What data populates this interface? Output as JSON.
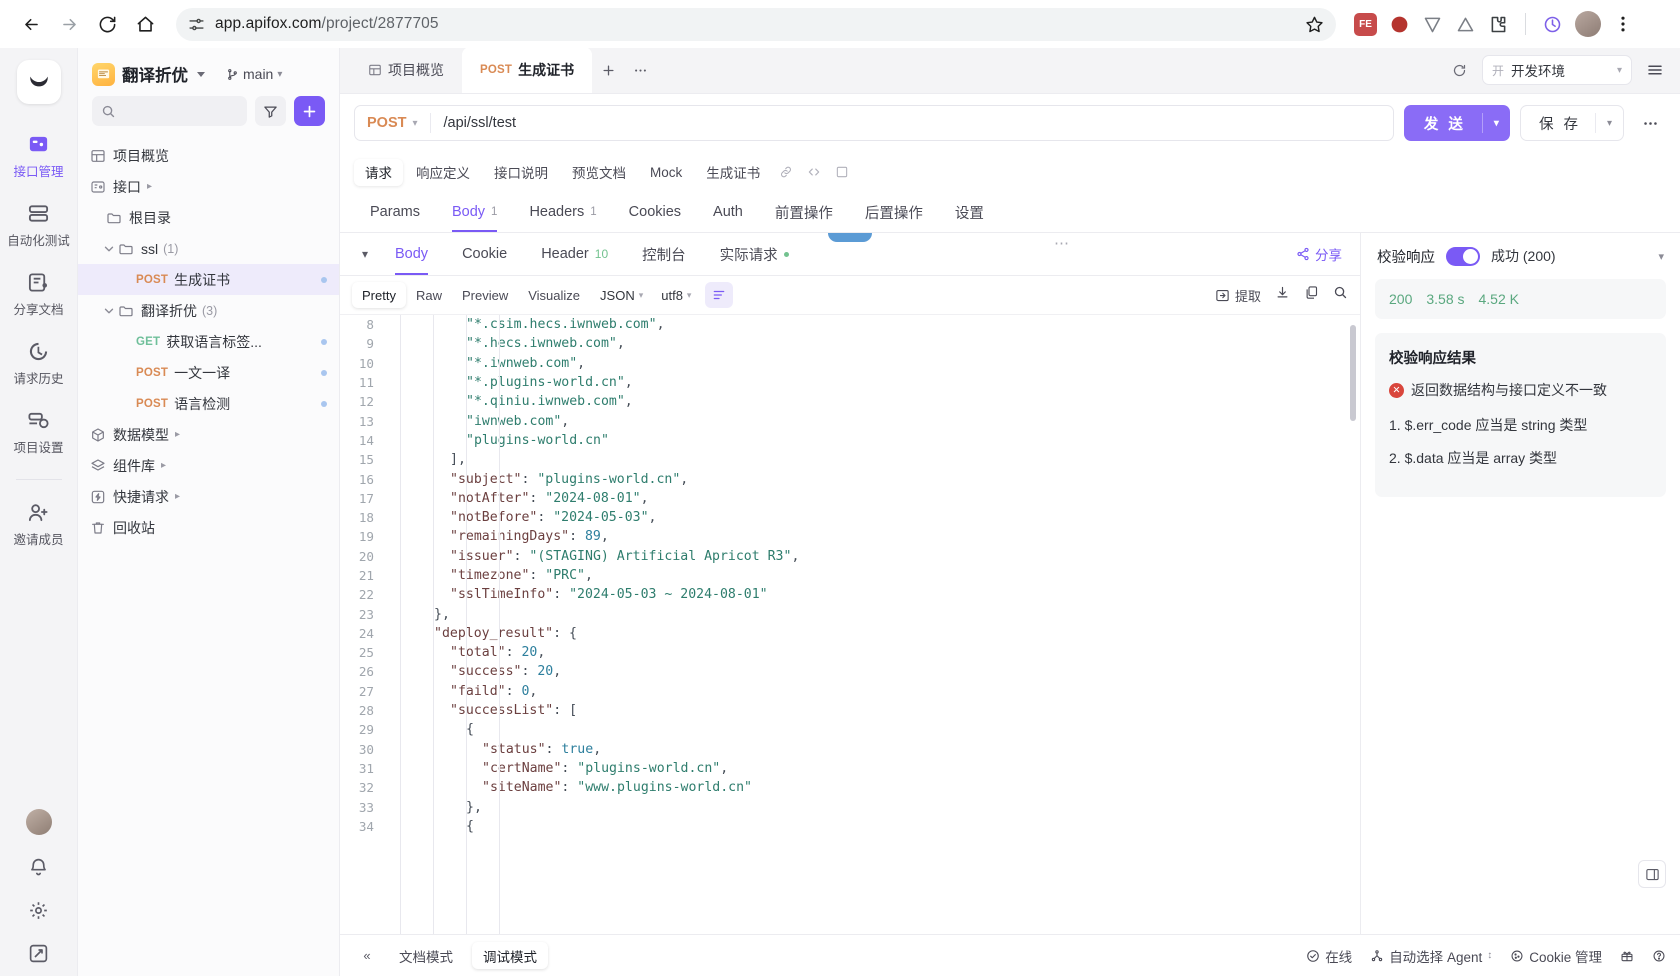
{
  "browser": {
    "url_prefix": "app.apifox.com",
    "url_suffix": "/project/2877705",
    "back_icon": "back-arrow-icon",
    "forward_icon": "forward-arrow-icon",
    "reload_icon": "reload-icon",
    "home_icon": "home-icon",
    "site_info_icon": "site-settings-icon",
    "bookmark_icon": "star-icon",
    "ext1_label": "FE",
    "menu_icon": "kebab-menu-icon"
  },
  "rail": {
    "logo": "apifox-logo",
    "items": [
      {
        "label": "接口管理",
        "icon": "api-management-icon",
        "active": true
      },
      {
        "label": "自动化测试",
        "icon": "automated-test-icon",
        "active": false
      },
      {
        "label": "分享文档",
        "icon": "share-doc-icon",
        "active": false
      },
      {
        "label": "请求历史",
        "icon": "history-icon",
        "active": false
      },
      {
        "label": "项目设置",
        "icon": "project-settings-icon",
        "active": false
      }
    ],
    "invite": {
      "label": "邀请成员",
      "icon": "invite-member-icon"
    },
    "bottom": [
      {
        "icon": "notification-bell-icon"
      },
      {
        "icon": "settings-gear-icon"
      },
      {
        "icon": "feedback-icon"
      }
    ]
  },
  "sidebar": {
    "project_name": "翻译折优",
    "project_icon": "project-thumbnail-icon",
    "branch": "main",
    "branch_icon": "git-branch-icon",
    "search_placeholder": "",
    "filter_icon": "filter-icon",
    "add_icon": "plus-icon",
    "tree": [
      {
        "label": "项目概览",
        "icon": "overview-icon",
        "indent": 0,
        "type": "node"
      },
      {
        "label": "接口",
        "icon": "api-folder-icon",
        "indent": 0,
        "type": "node",
        "arrow": true
      },
      {
        "label": "根目录",
        "icon": "folder-icon",
        "indent": 1,
        "type": "folder"
      },
      {
        "label": "ssl",
        "icon": "folder-icon",
        "indent": 1,
        "type": "folder",
        "count": "(1)",
        "expanded": true
      },
      {
        "label": "生成证书",
        "verb": "POST",
        "indent": 2,
        "type": "api",
        "selected": true,
        "dot": true
      },
      {
        "label": "翻译折优",
        "icon": "folder-icon",
        "indent": 1,
        "type": "folder",
        "count": "(3)",
        "expanded": true
      },
      {
        "label": "获取语言标签...",
        "verb": "GET",
        "indent": 2,
        "type": "api",
        "dot": true
      },
      {
        "label": "一文一译",
        "verb": "POST",
        "indent": 2,
        "type": "api",
        "dot": true
      },
      {
        "label": "语言检测",
        "verb": "POST",
        "indent": 2,
        "type": "api",
        "dot": true
      },
      {
        "label": "数据模型",
        "icon": "data-model-icon",
        "indent": 0,
        "type": "node",
        "arrow": true
      },
      {
        "label": "组件库",
        "icon": "component-library-icon",
        "indent": 0,
        "type": "node",
        "arrow": true
      },
      {
        "label": "快捷请求",
        "icon": "quick-request-icon",
        "indent": 0,
        "type": "node",
        "arrow": true
      },
      {
        "label": "回收站",
        "icon": "trash-icon",
        "indent": 0,
        "type": "node"
      }
    ]
  },
  "tabs": {
    "items": [
      {
        "label": "项目概览",
        "icon": "overview-icon",
        "active": false
      },
      {
        "label": "生成证书",
        "verb": "POST",
        "active": true
      }
    ],
    "add_icon": "plus-icon",
    "more_icon": "ellipsis-icon",
    "refresh_icon": "refresh-icon",
    "env_badge": "开",
    "env_label": "开发环境",
    "menu_icon": "list-menu-icon"
  },
  "request": {
    "method": "POST",
    "url": "/api/ssl/test",
    "send_label": "发 送",
    "save_label": "保 存",
    "more_icon": "ellipsis-icon"
  },
  "doc_tabs": {
    "items": [
      {
        "label": "请求",
        "active": true
      },
      {
        "label": "响应定义",
        "active": false
      },
      {
        "label": "接口说明",
        "active": false
      },
      {
        "label": "预览文档",
        "active": false
      },
      {
        "label": "Mock",
        "active": false
      },
      {
        "label": "生成证书",
        "active": false
      }
    ],
    "icons": [
      "link-icon",
      "code-icon",
      "panel-icon"
    ]
  },
  "sub_tabs": {
    "items": [
      {
        "label": "Params",
        "badge": "",
        "active": false
      },
      {
        "label": "Body",
        "badge": "1",
        "active": true
      },
      {
        "label": "Headers",
        "badge": "1",
        "active": false
      },
      {
        "label": "Cookies",
        "badge": "",
        "active": false
      },
      {
        "label": "Auth",
        "badge": "",
        "active": false
      },
      {
        "label": "前置操作",
        "badge": "",
        "active": false
      },
      {
        "label": "后置操作",
        "badge": "",
        "active": false
      },
      {
        "label": "设置",
        "badge": "",
        "active": false
      }
    ]
  },
  "response": {
    "collapse_icon": "chevron-down-icon",
    "tabs": [
      {
        "label": "Body",
        "badge": "",
        "active": true
      },
      {
        "label": "Cookie",
        "badge": "",
        "active": false
      },
      {
        "label": "Header",
        "badge": "10",
        "active": false
      },
      {
        "label": "控制台",
        "badge": "",
        "active": false
      },
      {
        "label": "实际请求",
        "badge": "",
        "active": false,
        "dot": true
      }
    ],
    "share_label": "分享",
    "share_icon": "share-icon",
    "format": {
      "modes": [
        {
          "label": "Pretty",
          "active": true
        },
        {
          "label": "Raw",
          "active": false
        },
        {
          "label": "Preview",
          "active": false
        },
        {
          "label": "Visualize",
          "active": false
        }
      ],
      "lang": "JSON",
      "encoding": "utf8",
      "wrap_icon": "word-wrap-icon",
      "extract_label": "提取",
      "extract_icon": "extract-icon",
      "download_icon": "download-icon",
      "copy_icon": "copy-icon",
      "search_icon": "search-icon"
    },
    "code_lines": [
      {
        "num": "8",
        "indent": 5,
        "tokens": [
          {
            "t": "s",
            "v": "\"*.csim.hecs.iwnweb.com\""
          },
          {
            "t": "p",
            "v": ","
          }
        ]
      },
      {
        "num": "9",
        "indent": 5,
        "tokens": [
          {
            "t": "s",
            "v": "\"*.hecs.iwnweb.com\""
          },
          {
            "t": "p",
            "v": ","
          }
        ]
      },
      {
        "num": "10",
        "indent": 5,
        "tokens": [
          {
            "t": "s",
            "v": "\"*.iwnweb.com\""
          },
          {
            "t": "p",
            "v": ","
          }
        ]
      },
      {
        "num": "11",
        "indent": 5,
        "tokens": [
          {
            "t": "s",
            "v": "\"*.plugins-world.cn\""
          },
          {
            "t": "p",
            "v": ","
          }
        ]
      },
      {
        "num": "12",
        "indent": 5,
        "tokens": [
          {
            "t": "s",
            "v": "\"*.qiniu.iwnweb.com\""
          },
          {
            "t": "p",
            "v": ","
          }
        ]
      },
      {
        "num": "13",
        "indent": 5,
        "tokens": [
          {
            "t": "s",
            "v": "\"iwnweb.com\""
          },
          {
            "t": "p",
            "v": ","
          }
        ]
      },
      {
        "num": "14",
        "indent": 5,
        "tokens": [
          {
            "t": "s",
            "v": "\"plugins-world.cn\""
          }
        ]
      },
      {
        "num": "15",
        "indent": 4,
        "tokens": [
          {
            "t": "p",
            "v": "],"
          }
        ]
      },
      {
        "num": "16",
        "indent": 4,
        "tokens": [
          {
            "t": "k",
            "v": "\"subject\""
          },
          {
            "t": "p",
            "v": ": "
          },
          {
            "t": "s",
            "v": "\"plugins-world.cn\""
          },
          {
            "t": "p",
            "v": ","
          }
        ]
      },
      {
        "num": "17",
        "indent": 4,
        "tokens": [
          {
            "t": "k",
            "v": "\"notAfter\""
          },
          {
            "t": "p",
            "v": ": "
          },
          {
            "t": "s",
            "v": "\"2024-08-01\""
          },
          {
            "t": "p",
            "v": ","
          }
        ]
      },
      {
        "num": "18",
        "indent": 4,
        "tokens": [
          {
            "t": "k",
            "v": "\"notBefore\""
          },
          {
            "t": "p",
            "v": ": "
          },
          {
            "t": "s",
            "v": "\"2024-05-03\""
          },
          {
            "t": "p",
            "v": ","
          }
        ]
      },
      {
        "num": "19",
        "indent": 4,
        "tokens": [
          {
            "t": "k",
            "v": "\"remainingDays\""
          },
          {
            "t": "p",
            "v": ": "
          },
          {
            "t": "n",
            "v": "89"
          },
          {
            "t": "p",
            "v": ","
          }
        ]
      },
      {
        "num": "20",
        "indent": 4,
        "tokens": [
          {
            "t": "k",
            "v": "\"issuer\""
          },
          {
            "t": "p",
            "v": ": "
          },
          {
            "t": "s",
            "v": "\"(STAGING) Artificial Apricot R3\""
          },
          {
            "t": "p",
            "v": ","
          }
        ]
      },
      {
        "num": "21",
        "indent": 4,
        "tokens": [
          {
            "t": "k",
            "v": "\"timezone\""
          },
          {
            "t": "p",
            "v": ": "
          },
          {
            "t": "s",
            "v": "\"PRC\""
          },
          {
            "t": "p",
            "v": ","
          }
        ]
      },
      {
        "num": "22",
        "indent": 4,
        "tokens": [
          {
            "t": "k",
            "v": "\"sslTimeInfo\""
          },
          {
            "t": "p",
            "v": ": "
          },
          {
            "t": "s",
            "v": "\"2024-05-03 ~ 2024-08-01\""
          }
        ]
      },
      {
        "num": "23",
        "indent": 3,
        "tokens": [
          {
            "t": "p",
            "v": "},"
          }
        ]
      },
      {
        "num": "24",
        "indent": 3,
        "tokens": [
          {
            "t": "k",
            "v": "\"deploy_result\""
          },
          {
            "t": "p",
            "v": ": {"
          }
        ]
      },
      {
        "num": "25",
        "indent": 4,
        "tokens": [
          {
            "t": "k",
            "v": "\"total\""
          },
          {
            "t": "p",
            "v": ": "
          },
          {
            "t": "n",
            "v": "20"
          },
          {
            "t": "p",
            "v": ","
          }
        ]
      },
      {
        "num": "26",
        "indent": 4,
        "tokens": [
          {
            "t": "k",
            "v": "\"success\""
          },
          {
            "t": "p",
            "v": ": "
          },
          {
            "t": "n",
            "v": "20"
          },
          {
            "t": "p",
            "v": ","
          }
        ]
      },
      {
        "num": "27",
        "indent": 4,
        "tokens": [
          {
            "t": "k",
            "v": "\"faild\""
          },
          {
            "t": "p",
            "v": ": "
          },
          {
            "t": "n",
            "v": "0"
          },
          {
            "t": "p",
            "v": ","
          }
        ]
      },
      {
        "num": "28",
        "indent": 4,
        "tokens": [
          {
            "t": "k",
            "v": "\"successList\""
          },
          {
            "t": "p",
            "v": ": ["
          }
        ]
      },
      {
        "num": "29",
        "indent": 5,
        "tokens": [
          {
            "t": "p",
            "v": "{"
          }
        ]
      },
      {
        "num": "30",
        "indent": 6,
        "tokens": [
          {
            "t": "k",
            "v": "\"status\""
          },
          {
            "t": "p",
            "v": ": "
          },
          {
            "t": "b",
            "v": "true"
          },
          {
            "t": "p",
            "v": ","
          }
        ]
      },
      {
        "num": "31",
        "indent": 6,
        "tokens": [
          {
            "t": "k",
            "v": "\"certName\""
          },
          {
            "t": "p",
            "v": ": "
          },
          {
            "t": "s",
            "v": "\"plugins-world.cn\""
          },
          {
            "t": "p",
            "v": ","
          }
        ]
      },
      {
        "num": "32",
        "indent": 6,
        "tokens": [
          {
            "t": "k",
            "v": "\"siteName\""
          },
          {
            "t": "p",
            "v": ": "
          },
          {
            "t": "s",
            "v": "\"www.plugins-world.cn\""
          }
        ]
      },
      {
        "num": "33",
        "indent": 5,
        "tokens": [
          {
            "t": "p",
            "v": "},"
          }
        ]
      },
      {
        "num": "34",
        "indent": 5,
        "tokens": [
          {
            "t": "p",
            "v": "{"
          }
        ]
      }
    ]
  },
  "validation": {
    "title": "校验响应",
    "status": "成功 (200)",
    "stats": [
      "200",
      "3.58 s",
      "4.52 K"
    ],
    "result_title": "校验响应结果",
    "error_main": "返回数据结构与接口定义不一致",
    "error_items": [
      "1. $.err_code 应当是 string 类型",
      "2. $.data 应当是 array 类型"
    ],
    "collapse_icon": "chevron-down-icon"
  },
  "statusbar": {
    "collapse_icon": "double-chevron-left-icon",
    "modes": [
      {
        "label": "文档模式",
        "active": false
      },
      {
        "label": "调试模式",
        "active": true
      }
    ],
    "online_label": "在线",
    "online_icon": "check-circle-icon",
    "agent_label": "自动选择 Agent",
    "agent_icon": "agent-icon",
    "cookie_label": "Cookie 管理",
    "cookie_icon": "cookie-icon",
    "gift_icon": "gift-icon",
    "help_icon": "help-icon",
    "panel_icon": "panel-toggle-icon"
  }
}
